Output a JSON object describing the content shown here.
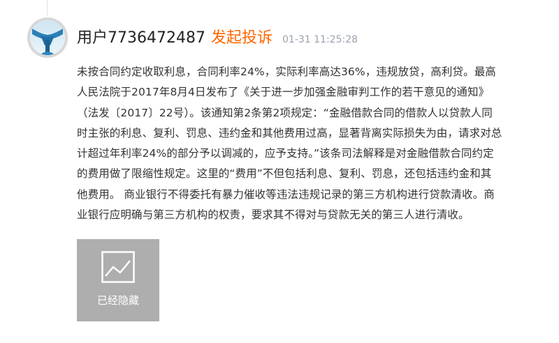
{
  "post": {
    "username": "用户7736472487",
    "action": "发起投诉",
    "timestamp": "01-31 11:25:28",
    "avatar_icon": "avatar-icon",
    "content_lines": [
      "未按合同约定收取利息，合同利率24%，实际利率高达36%，违规放贷，高利贷。最高",
      "人民法院于2017年8月4日发布了《关于进一步加强金融审判工作的若干意见的通知》",
      "（法发〔2017〕22号）。该通知第2条第2项规定：“金融借款合同的借款人以贷款人同",
      "时主张的利息、复利、罚息、违约金和其他费用过高，显著背离实际损失为由，请求对总",
      "计超过年利率24%的部分予以调减的，应予支持。”该条司法解释是对金融借款合同约定",
      "的费用做了限缩性规定。这里的“费用”不但包括利息、复利、罚息，还包括违约金和其",
      "他费用。 商业银行不得委托有暴力催收等违法违规记录的第三方机构进行贷款清收。商",
      "业银行应明确与第三方机构的权责，要求其不得对与贷款无关的第三人进行清收。"
    ],
    "attachment": {
      "icon": "image-icon",
      "label": "已经隐藏"
    }
  },
  "colors": {
    "action": "#ff6600",
    "timestamp": "#9aa3ad",
    "text": "#333333",
    "hidden_bg": "#aeaeae"
  }
}
